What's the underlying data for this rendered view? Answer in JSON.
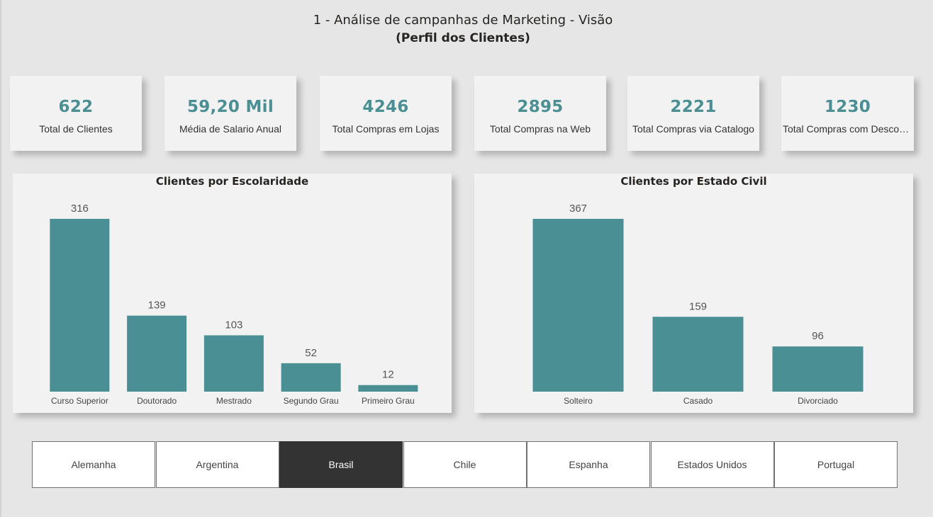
{
  "header": {
    "title": "1 - Análise de campanhas de Marketing - Visão",
    "subtitle": "(Perfil dos Clientes)"
  },
  "kpis": [
    {
      "value": "622",
      "label": "Total de Clientes"
    },
    {
      "value": "59,20 Mil",
      "label": "Média de Salario Anual"
    },
    {
      "value": "4246",
      "label": "Total  Compras em Lojas"
    },
    {
      "value": "2895",
      "label": "Total Compras na Web"
    },
    {
      "value": "2221",
      "label": "Total Compras via Catalogo"
    },
    {
      "value": "1230",
      "label": "Total Compras com Descon..."
    }
  ],
  "chart_data": [
    {
      "type": "bar",
      "title": "Clientes por Escolaridade",
      "categories": [
        "Curso Superior",
        "Doutorado",
        "Mestrado",
        "Segundo Grau",
        "Primeiro Grau"
      ],
      "values": [
        316,
        139,
        103,
        52,
        12
      ],
      "data_labels": true,
      "xlabel": "",
      "ylabel": "",
      "ylim": [
        0,
        316
      ],
      "grid": false,
      "color": "#4a8f93"
    },
    {
      "type": "bar",
      "title": "Clientes por Estado Civil",
      "categories": [
        "Solteiro",
        "Casado",
        "Divorciado"
      ],
      "values": [
        367,
        159,
        96
      ],
      "data_labels": true,
      "xlabel": "",
      "ylabel": "",
      "ylim": [
        0,
        367
      ],
      "grid": false,
      "color": "#4a8f93"
    }
  ],
  "slicer": {
    "options": [
      "Alemanha",
      "Argentina",
      "Brasil",
      "Chile",
      "Espanha",
      "Estados Unidos",
      "Portugal"
    ],
    "selected": "Brasil"
  },
  "colors": {
    "accent": "#4a8f93",
    "background": "#e6e6e6",
    "card": "#f2f2f2",
    "selected_button": "#333333"
  }
}
